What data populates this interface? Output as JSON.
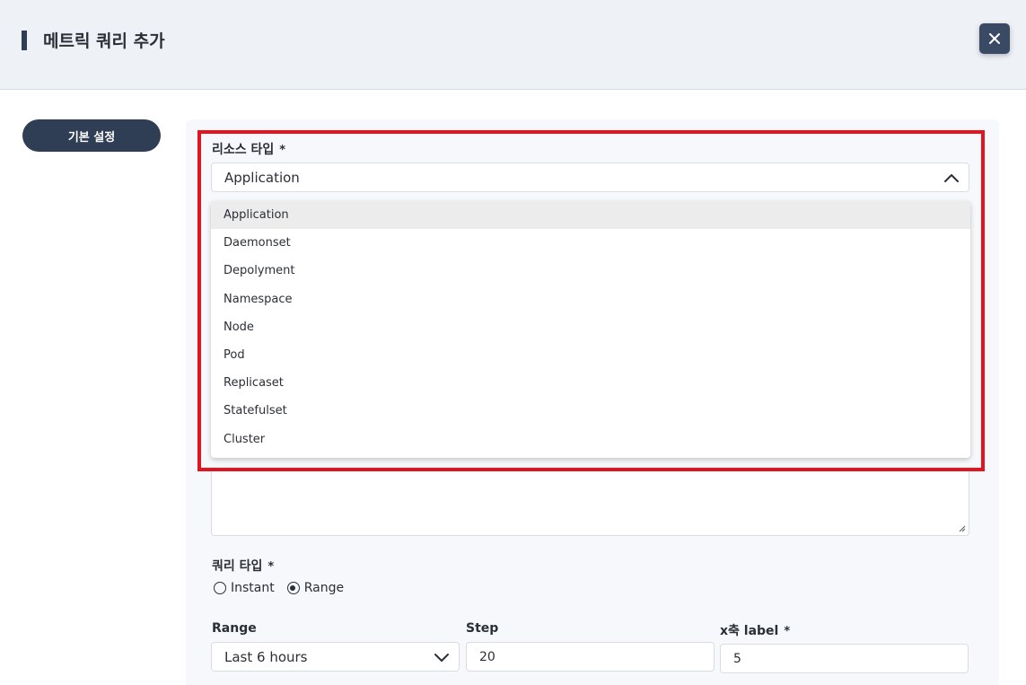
{
  "header": {
    "title": "메트릭 쿼리 추가"
  },
  "sidebar": {
    "tab_label": "기본 설정"
  },
  "resource_type": {
    "label": "리소스 타입",
    "required_mark": "*",
    "selected_value": "Application",
    "options": [
      "Application",
      "Daemonset",
      "Depolyment",
      "Namespace",
      "Node",
      "Pod",
      "Replicaset",
      "Statefulset",
      "Cluster"
    ]
  },
  "query_type": {
    "label": "쿼리 타입",
    "required_mark": "*",
    "options": [
      "Instant",
      "Range"
    ],
    "selected": "Range"
  },
  "range": {
    "label": "Range",
    "value": "Last 6 hours"
  },
  "step": {
    "label": "Step",
    "value": "20"
  },
  "x_label": {
    "label": "x축 label",
    "required_mark": "*",
    "value": "5"
  },
  "colors": {
    "header_bg": "#eef2f7",
    "primary": "#2f3d55",
    "highlight_border": "#e3141f",
    "panel_bg": "#f6f8fb"
  },
  "icons": {
    "close": "close-icon",
    "dropdown_open": "chevron-up-icon",
    "dropdown_closed": "chevron-down-icon"
  }
}
